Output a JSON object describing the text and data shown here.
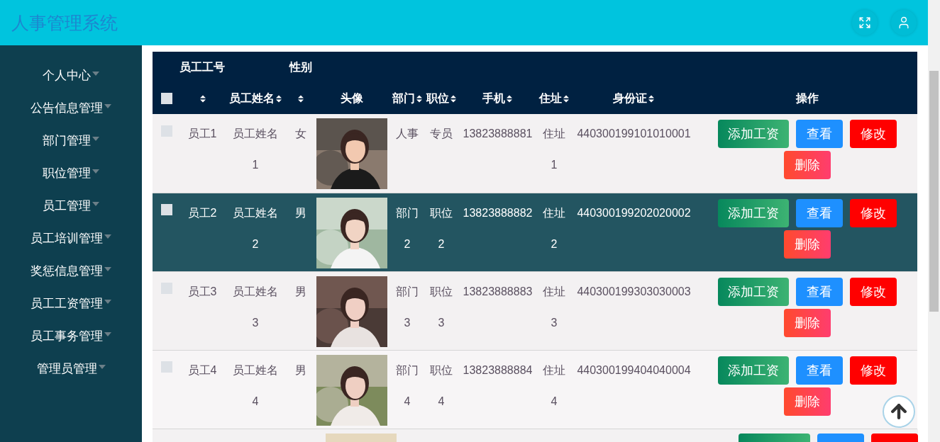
{
  "app": {
    "title": "人事管理系统"
  },
  "header_buttons": [
    {
      "kind": "fullscreen"
    },
    {
      "kind": "user"
    }
  ],
  "sidebar": {
    "items": [
      {
        "label": "个人中心"
      },
      {
        "label": "公告信息管理"
      },
      {
        "label": "部门管理"
      },
      {
        "label": "职位管理"
      },
      {
        "label": "员工管理"
      },
      {
        "label": "员工培训管理"
      },
      {
        "label": "奖惩信息管理"
      },
      {
        "label": "员工工资管理"
      },
      {
        "label": "员工事务管理"
      },
      {
        "label": "管理员管理"
      }
    ]
  },
  "table": {
    "columns": [
      {
        "kind": "checkbox",
        "checked": false
      },
      {
        "kind": "text",
        "label": "员工工号",
        "sortable": true
      },
      {
        "kind": "text",
        "label": "员工姓名",
        "sortable": true
      },
      {
        "kind": "text",
        "label": "性别",
        "sortable": true
      },
      {
        "kind": "text",
        "label": "头像",
        "sortable": false
      },
      {
        "kind": "text",
        "label": "部门",
        "sortable": true
      },
      {
        "kind": "text",
        "label": "职位",
        "sortable": true
      },
      {
        "kind": "text",
        "label": "手机",
        "sortable": true
      },
      {
        "kind": "text",
        "label": "住址",
        "sortable": true
      },
      {
        "kind": "text",
        "label": "身份证",
        "sortable": true
      },
      {
        "kind": "text",
        "label": "操作",
        "sortable": false
      }
    ],
    "rows": [
      {
        "selected": false,
        "cells": [
          {
            "kind": "checkbox",
            "checked": false
          },
          "员工1",
          "员工姓名1",
          "女",
          {
            "kind": "picture"
          },
          "人事",
          "专员",
          "13823888881",
          "住址1",
          "440300199101010001",
          {
            "kind": "actions",
            "buttons": [
              {
                "kind": "add",
                "label": "添加工资"
              },
              {
                "kind": "view",
                "label": "查看"
              },
              {
                "kind": "edit",
                "label": "修改"
              },
              {
                "kind": "delete",
                "label": "删除"
              }
            ]
          }
        ]
      },
      {
        "selected": true,
        "cells": [
          {
            "kind": "checkbox",
            "checked": false
          },
          "员工2",
          "员工姓名2",
          "男",
          {
            "kind": "picture"
          },
          "部门2",
          "职位2",
          "13823888882",
          "住址2",
          "440300199202020002",
          {
            "kind": "actions",
            "buttons": [
              {
                "kind": "add",
                "label": "添加工资"
              },
              {
                "kind": "view",
                "label": "查看"
              },
              {
                "kind": "edit",
                "label": "修改"
              },
              {
                "kind": "delete",
                "label": "删除"
              }
            ]
          }
        ]
      },
      {
        "selected": false,
        "cells": [
          {
            "kind": "checkbox",
            "checked": false
          },
          "员工3",
          "员工姓名3",
          "男",
          {
            "kind": "picture"
          },
          "部门3",
          "职位3",
          "13823888883",
          "住址3",
          "440300199303030003",
          {
            "kind": "actions",
            "buttons": [
              {
                "kind": "add",
                "label": "添加工资"
              },
              {
                "kind": "view",
                "label": "查看"
              },
              {
                "kind": "edit",
                "label": "修改"
              },
              {
                "kind": "delete",
                "label": "删除"
              }
            ]
          }
        ]
      },
      {
        "selected": false,
        "cells": [
          {
            "kind": "checkbox",
            "checked": false
          },
          "员工4",
          "员工姓名4",
          "男",
          {
            "kind": "picture"
          },
          "部门4",
          "职位4",
          "13823888884",
          "住址4",
          "440300199404040004",
          {
            "kind": "actions",
            "buttons": [
              {
                "kind": "add",
                "label": "添加工资"
              },
              {
                "kind": "view",
                "label": "查看"
              },
              {
                "kind": "edit",
                "label": "修改"
              },
              {
                "kind": "delete",
                "label": "删除"
              }
            ]
          }
        ]
      }
    ]
  }
}
